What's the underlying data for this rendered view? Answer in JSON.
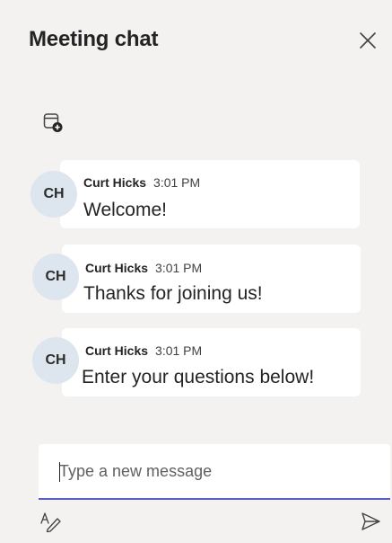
{
  "header": {
    "title": "Meeting chat",
    "close_icon": "close-icon"
  },
  "meeting_icon": "calendar-add-icon",
  "messages": [
    {
      "avatar": "CH",
      "sender": "Curt Hicks",
      "time": "3:01 PM",
      "text": "Welcome!"
    },
    {
      "avatar": "CH",
      "sender": "Curt Hicks",
      "time": "3:01 PM",
      "text": "Thanks for joining us!"
    },
    {
      "avatar": "CH",
      "sender": "Curt Hicks",
      "time": "3:01 PM",
      "text": "Enter your questions below!"
    }
  ],
  "compose": {
    "placeholder": "Type a new message",
    "format_icon": "format-icon",
    "send_icon": "send-icon"
  },
  "colors": {
    "background": "#f3f2f1",
    "bubble": "#ffffff",
    "avatar_bg": "#dde6ee",
    "accent": "#5b5fc7"
  }
}
